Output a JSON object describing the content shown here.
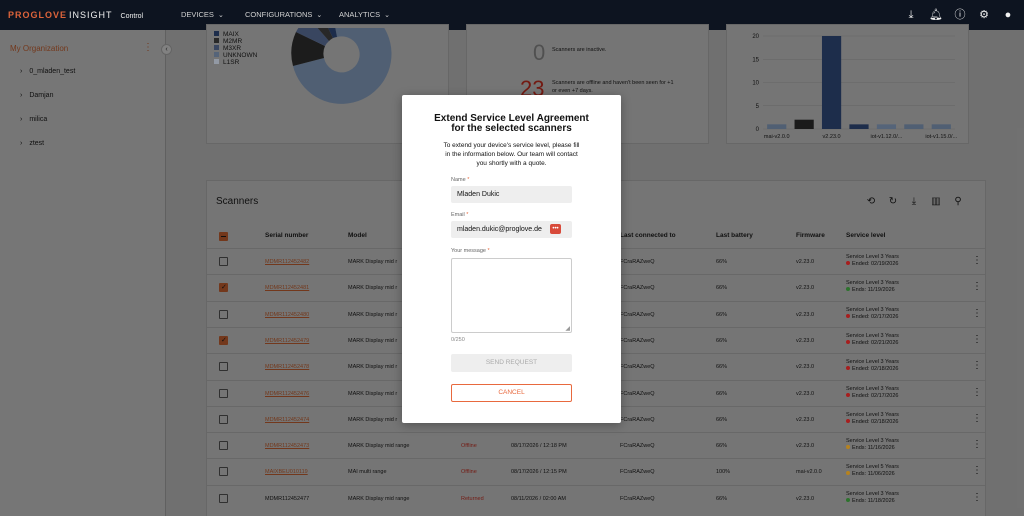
{
  "header": {
    "brand": "PROGLOVE",
    "product": "INSIGHT",
    "context": "Control",
    "nav": [
      {
        "label": "DEVICES"
      },
      {
        "label": "CONFIGURATIONS"
      },
      {
        "label": "ANALYTICS"
      }
    ],
    "icons": [
      "download-icon",
      "bell-icon",
      "help-icon",
      "gear-icon",
      "account-icon"
    ]
  },
  "sidebar": {
    "org_name": "My Organization",
    "items": [
      {
        "label": "0_mladen_test"
      },
      {
        "label": "Damjan"
      },
      {
        "label": "milica"
      },
      {
        "label": "ztest"
      }
    ]
  },
  "donut_card": {
    "legend": [
      {
        "label": "MAIX",
        "color": "#1f3050"
      },
      {
        "label": "M2MR",
        "color": "#2b2b2b"
      },
      {
        "label": "M3XR",
        "color": "#3d4a66"
      },
      {
        "label": "UNKNOWN",
        "color": "#5a6a80"
      },
      {
        "label": "L1SR",
        "color": "#9aa2ad"
      }
    ]
  },
  "stats_card": {
    "inactive_count": "0",
    "inactive_text": "Scanners are inactive.",
    "offline_count": "23",
    "offline_text_1": "Scanners are offline and haven't been seen for +1",
    "offline_text_2": "or even +7 days."
  },
  "chart_data": {
    "type": "bar",
    "categories": [
      "mai-v2.0.0",
      "",
      "v2.23.0",
      "",
      "iot-v1.12.0/...",
      "",
      "iot-v1.15.0/..."
    ],
    "values": [
      1,
      2,
      20,
      1,
      1,
      1,
      1
    ],
    "yticks": [
      0,
      5,
      10,
      15,
      20
    ],
    "ylim": [
      0,
      20
    ],
    "colors": [
      "#55657a",
      "#1c1c1c",
      "#1f3050",
      "#1f3050",
      "#5a6a80",
      "#55657a",
      "#55657a"
    ]
  },
  "scanners": {
    "title": "Scanners",
    "tool_icons": [
      "history-icon",
      "refresh-icon",
      "export-icon",
      "columns-icon",
      "search-icon"
    ],
    "columns": {
      "serial": "Serial number",
      "model": "Model",
      "last_connected": "Last connected to",
      "last_battery": "Last battery",
      "firmware": "Firmware",
      "service_level": "Service level"
    },
    "rows": [
      {
        "serial": "MDMR112452482",
        "model": "MARK Display mid r",
        "status": "",
        "date": "",
        "gateway": "FCraRAZweQ",
        "battery": "66%",
        "firmware": "v2.23.0",
        "sl": "Service Level 3 Years",
        "ends": "Ended: 02/19/2026",
        "dot": "#b02020",
        "checked": false,
        "link": true
      },
      {
        "serial": "MDMR112452481",
        "model": "MARK Display mid r",
        "status": "",
        "date": "",
        "gateway": "FCraRAZweQ",
        "battery": "66%",
        "firmware": "v2.23.0",
        "sl": "Service Level 3 Years",
        "ends": "Ends: 11/19/2026",
        "dot": "#2f7a2f",
        "checked": true,
        "link": true
      },
      {
        "serial": "MDMR112452480",
        "model": "MARK Display mid r",
        "status": "",
        "date": "",
        "gateway": "FCraRAZweQ",
        "battery": "66%",
        "firmware": "v2.23.0",
        "sl": "Service Level 3 Years",
        "ends": "Ended: 02/17/2026",
        "dot": "#b02020",
        "checked": false,
        "link": true
      },
      {
        "serial": "MDMR112452479",
        "model": "MARK Display mid r",
        "status": "",
        "date": "",
        "gateway": "FCraRAZweQ",
        "battery": "66%",
        "firmware": "v2.23.0",
        "sl": "Service Level 3 Years",
        "ends": "Ended: 02/21/2026",
        "dot": "#b02020",
        "checked": true,
        "link": true
      },
      {
        "serial": "MDMR112452478",
        "model": "MARK Display mid r",
        "status": "",
        "date": "",
        "gateway": "FCraRAZweQ",
        "battery": "66%",
        "firmware": "v2.23.0",
        "sl": "Service Level 3 Years",
        "ends": "Ended: 02/18/2026",
        "dot": "#b02020",
        "checked": false,
        "link": true
      },
      {
        "serial": "MDMR112452476",
        "model": "MARK Display mid r",
        "status": "",
        "date": "",
        "gateway": "FCraRAZweQ",
        "battery": "66%",
        "firmware": "v2.23.0",
        "sl": "Service Level 3 Years",
        "ends": "Ended: 02/17/2026",
        "dot": "#b02020",
        "checked": false,
        "link": true
      },
      {
        "serial": "MDMR112452474",
        "model": "MARK Display mid r",
        "status": "",
        "date": "",
        "gateway": "FCraRAZweQ",
        "battery": "66%",
        "firmware": "v2.23.0",
        "sl": "Service Level 3 Years",
        "ends": "Ended: 02/18/2026",
        "dot": "#b02020",
        "checked": false,
        "link": true
      },
      {
        "serial": "MDMR112452473",
        "model": "MARK Display mid range",
        "status": "Offline",
        "date": "08/17/2026 / 12:18 PM",
        "gateway": "FCraRAZweQ",
        "battery": "66%",
        "firmware": "v2.23.0",
        "sl": "Service Level 3 Years",
        "ends": "Ends: 11/16/2026",
        "dot": "#c08a20",
        "checked": false,
        "link": true
      },
      {
        "serial": "MAIXBEU010119",
        "model": "MAI multi range",
        "status": "Offline",
        "date": "08/17/2026 / 12:15 PM",
        "gateway": "FCraRAZweQ",
        "battery": "100%",
        "firmware": "mai-v2.0.0",
        "sl": "Service Level 5 Years",
        "ends": "Ends: 11/06/2026",
        "dot": "#c08a20",
        "checked": false,
        "link": true
      },
      {
        "serial": "MDMR112452477",
        "model": "MARK Display mid range",
        "status": "Returned",
        "date": "08/11/2026 / 02:00 AM",
        "gateway": "FCraRAZweQ",
        "battery": "66%",
        "firmware": "v2.23.0",
        "sl": "Service Level 3 Years",
        "ends": "Ends: 11/18/2026",
        "dot": "#2f7a2f",
        "checked": false,
        "link": false
      }
    ]
  },
  "modal": {
    "title_line1": "Extend Service Level Agreement",
    "title_line2": "for the selected scanners",
    "desc_line1": "To extend your device's service level, please fill",
    "desc_line2": "in the information below. Our team will contact",
    "desc_line3": "you shortly with a quote.",
    "name_label": "Name",
    "name_value": "Mladen Dukic",
    "email_label": "Email",
    "email_value": "mladen.dukic@proglove.de",
    "message_label": "Your message",
    "required_mark": "*",
    "counter": "0/250",
    "send_label": "SEND REQUEST",
    "cancel_label": "CANCEL",
    "password_manager_glyph": "•••"
  }
}
